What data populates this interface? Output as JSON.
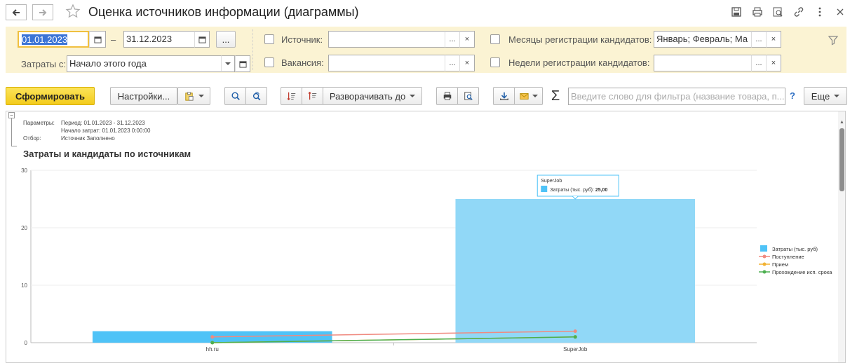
{
  "window": {
    "title": "Оценка источников информации (диаграммы)"
  },
  "filters": {
    "date_from": "01.01.2023",
    "date_dash": "–",
    "date_to": "31.12.2023",
    "ellipsis": "...",
    "costs_from_label": "Затраты с:",
    "costs_from_value": "Начало этого года",
    "source_label": "Источник:",
    "source_value": "",
    "vacancy_label": "Вакансия:",
    "vacancy_value": "",
    "months_label": "Месяцы регистрации кандидатов:",
    "months_value": "Январь; Февраль; Ма",
    "weeks_label": "Недели регистрации кандидатов:",
    "weeks_value": ""
  },
  "toolbar": {
    "generate": "Сформировать",
    "settings": "Настройки...",
    "expand_to": "Разворачивать до",
    "search_placeholder": "Введите слово для фильтра (название товара, п...",
    "help": "?",
    "more": "Еще",
    "sigma": "Σ"
  },
  "report": {
    "params_label": "Параметры:",
    "period_line": "Период: 01.01.2023 - 31.12.2023",
    "costs_start_line": "Начало затрат: 01.01.2023 0:00:00",
    "selection_label": "Отбор:",
    "selection_value": "Источник Заполнено",
    "chart_heading": "Затраты и кандидаты по источникам"
  },
  "chart_data": {
    "type": "bar",
    "categories": [
      "hh.ru",
      "SuperJob"
    ],
    "ylim": [
      0,
      30
    ],
    "yticks": [
      0,
      10,
      20,
      30
    ],
    "series": [
      {
        "name": "Затраты (тыс. руб)",
        "kind": "bar",
        "color": "#4fc3f7",
        "values": [
          2,
          25
        ]
      },
      {
        "name": "Поступление",
        "kind": "line",
        "color": "#f08a80",
        "values": [
          1,
          2
        ]
      },
      {
        "name": "Прием",
        "kind": "line",
        "color": "#f2b233",
        "values": [
          0,
          1
        ]
      },
      {
        "name": "Прохождение исп. срока",
        "kind": "line",
        "color": "#4caf50",
        "values": [
          0,
          1
        ]
      }
    ],
    "tooltip": {
      "category": "SuperJob",
      "series_label": "Затраты (тыс. руб):",
      "value_text": "25,00"
    },
    "legend_position": "right"
  }
}
